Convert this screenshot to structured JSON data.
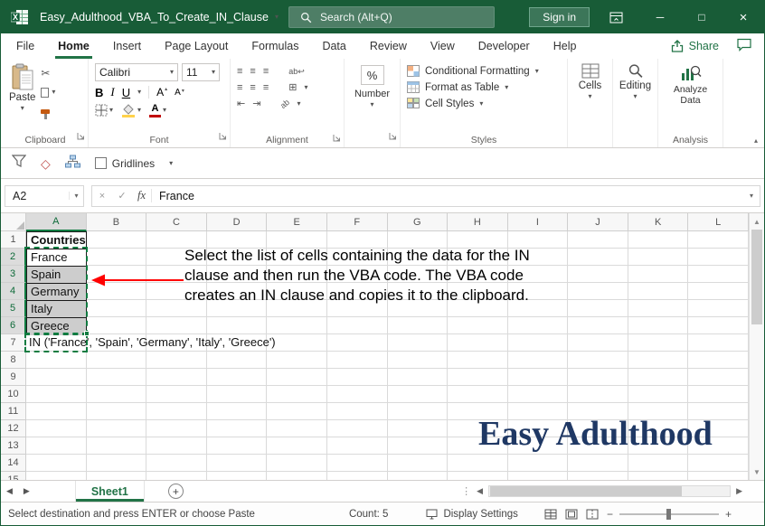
{
  "titlebar": {
    "title": "Easy_Adulthood_VBA_To_Create_IN_Clause",
    "search_placeholder": "Search (Alt+Q)",
    "sign_in": "Sign in"
  },
  "tabs": {
    "items": [
      "File",
      "Home",
      "Insert",
      "Page Layout",
      "Formulas",
      "Data",
      "Review",
      "View",
      "Developer",
      "Help"
    ],
    "active": "Home",
    "share": "Share"
  },
  "ribbon": {
    "paste": "Paste",
    "clipboard_group": "Clipboard",
    "font_name": "Calibri",
    "font_size": "11",
    "bold": "B",
    "italic": "I",
    "underline": "U",
    "font_group": "Font",
    "alignment_group": "Alignment",
    "percent": "%",
    "number_label": "Number",
    "conditional_formatting": "Conditional Formatting",
    "format_as_table": "Format as Table",
    "cell_styles": "Cell Styles",
    "styles_group": "Styles",
    "cells": "Cells",
    "editing": "Editing",
    "analyze_data": "Analyze Data",
    "analysis_group": "Analysis"
  },
  "quick_toolbar": {
    "gridlines": "Gridlines"
  },
  "formula_bar": {
    "name_box": "A2",
    "fx": "fx",
    "value": "France"
  },
  "grid": {
    "columns": [
      "A",
      "B",
      "C",
      "D",
      "E",
      "F",
      "G",
      "H",
      "I",
      "J",
      "K",
      "L"
    ],
    "row_count": 15,
    "selected_columns": [
      "A"
    ],
    "selected_rows": [
      2,
      3,
      4,
      5,
      6
    ],
    "cells": {
      "A1": "Countries",
      "A2": "France",
      "A3": "Spain",
      "A4": "Germany",
      "A5": "Italy",
      "A6": "Greece",
      "A7": "IN ('France', 'Spain', 'Germany', 'Italy', 'Greece')"
    },
    "annotation_lines": [
      "Select the list of cells containing the data for the IN",
      "clause and then run the VBA code. The VBA code",
      "creates an IN clause and copies it to the clipboard."
    ],
    "logo": "Easy Adulthood"
  },
  "sheet_bar": {
    "active_tab": "Sheet1"
  },
  "status_bar": {
    "message": "Select destination and press ENTER or choose Paste",
    "count": "Count: 5",
    "display_settings": "Display Settings"
  },
  "colors": {
    "accent_green": "#217346",
    "titlebar_green": "#185C37",
    "selection_fill": "#CDCDCD",
    "marquee_green": "#107C41",
    "logo_navy": "#1F3864",
    "arrow_red": "#FF0000"
  },
  "icons": {
    "caret": "▾",
    "cut": "✂",
    "check": "✓",
    "close": "×",
    "minimize": "─",
    "maximize": "□",
    "nav_left": "◀",
    "nav_right": "▶",
    "scroll_up": "▲",
    "scroll_down": "▼",
    "dots": "⋮",
    "align_lines": "≡",
    "grid_square": "⊞",
    "plus": "+",
    "minus": "−",
    "diamond": "◇",
    "indent_left": "⇤",
    "indent_right": "⇥",
    "wrap_ab": "ab↩",
    "orient_ab": "ab"
  }
}
